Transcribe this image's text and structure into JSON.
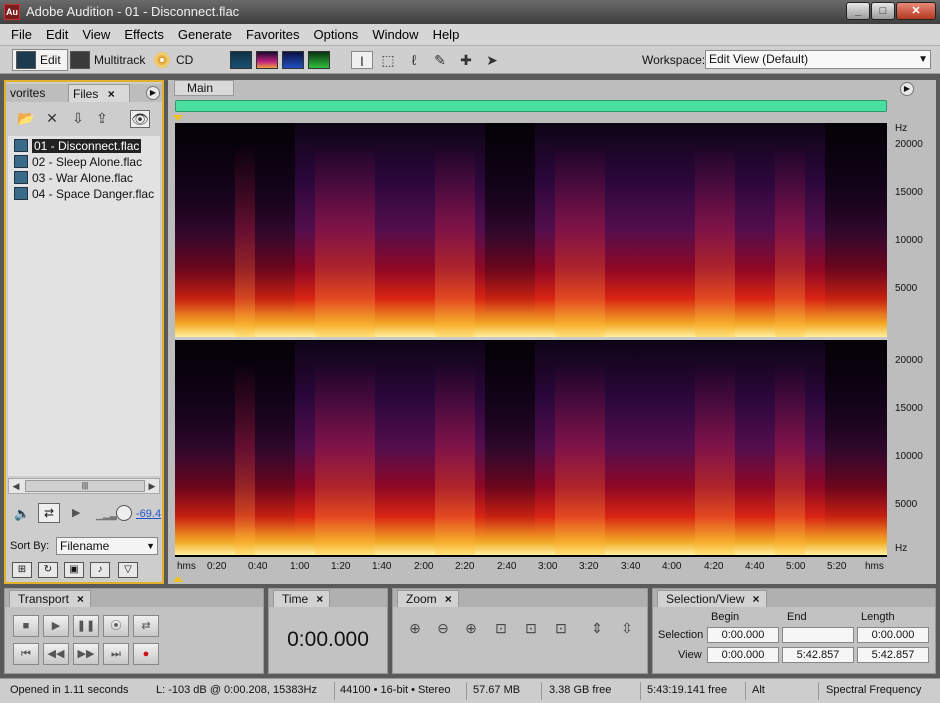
{
  "window": {
    "title": "Adobe Audition - 01 - Disconnect.flac",
    "app_icon": "Au"
  },
  "menu": [
    "File",
    "Edit",
    "View",
    "Effects",
    "Generate",
    "Favorites",
    "Options",
    "Window",
    "Help"
  ],
  "toolbar": {
    "edit_label": "Edit",
    "multitrack_label": "Multitrack",
    "cd_label": "CD",
    "workspace_label": "Workspace:",
    "workspace_value": "Edit View (Default)"
  },
  "files_panel": {
    "tab_favorites": "vorites",
    "tab_files": "Files",
    "files": [
      "01 - Disconnect.flac",
      "02 - Sleep Alone.flac",
      "03 - War Alone.flac",
      "04 - Space Danger.flac"
    ],
    "volume_value": "-69.4",
    "sort_label": "Sort By:",
    "sort_value": "Filename"
  },
  "main": {
    "tab": "Main",
    "hz_unit": "Hz",
    "hz_ticks": [
      "20000",
      "15000",
      "10000",
      "5000"
    ],
    "time_ticks": [
      "hms",
      "0:20",
      "0:40",
      "1:00",
      "1:20",
      "1:40",
      "2:00",
      "2:20",
      "2:40",
      "3:00",
      "3:20",
      "3:40",
      "4:00",
      "4:20",
      "4:40",
      "5:00",
      "5:20",
      "hms"
    ]
  },
  "transport": {
    "title": "Transport"
  },
  "time_panel": {
    "title": "Time",
    "value": "0:00.000"
  },
  "zoom_panel": {
    "title": "Zoom"
  },
  "selection": {
    "title": "Selection/View",
    "col_begin": "Begin",
    "col_end": "End",
    "col_length": "Length",
    "row_selection": "Selection",
    "row_view": "View",
    "sel_begin": "0:00.000",
    "sel_end": "",
    "sel_length": "0:00.000",
    "view_begin": "0:00.000",
    "view_end": "5:42.857",
    "view_length": "5:42.857"
  },
  "status": {
    "opened": "Opened in 1.11 seconds",
    "level": "L: -103 dB @  0:00.208, 15383Hz",
    "format": "44100 • 16-bit • Stereo",
    "size": "57.67 MB",
    "free": "3.38 GB free",
    "free_time": "5:43:19.141 free",
    "alt": "Alt",
    "view_mode": "Spectral Frequency"
  },
  "colors": {
    "accent_border": "#e6b12a",
    "overview": "#4adfa0"
  }
}
